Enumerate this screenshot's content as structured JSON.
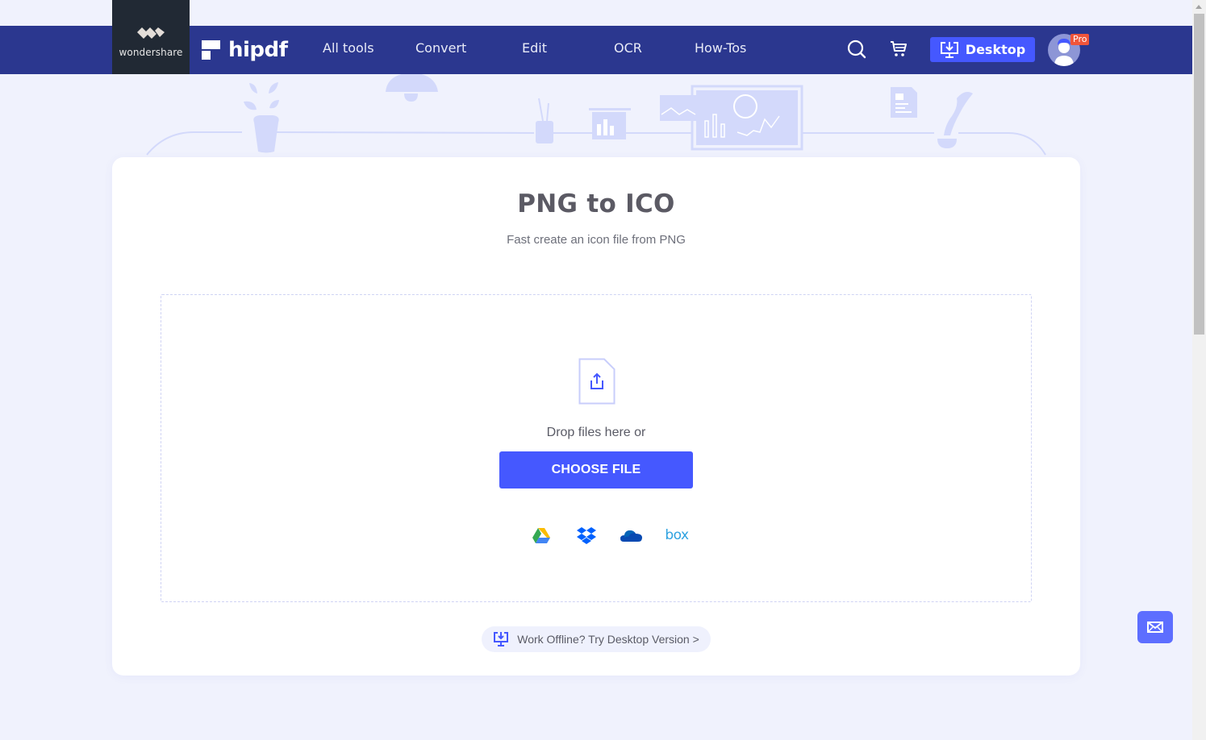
{
  "header": {
    "brand_parent": "wondershare",
    "brand": "hipdf",
    "nav": [
      {
        "label": "All tools"
      },
      {
        "label": "Convert"
      },
      {
        "label": "Edit"
      },
      {
        "label": "OCR"
      },
      {
        "label": "How-Tos"
      }
    ],
    "icons": {
      "search": "search-icon",
      "cart": "cart-icon"
    },
    "desktop_button": "Desktop",
    "pro_badge": "Pro"
  },
  "main": {
    "title": "PNG to ICO",
    "subtitle": "Fast create an icon file from PNG",
    "drop_text": "Drop files here or",
    "choose_button": "CHOOSE FILE",
    "cloud_sources": [
      {
        "name": "Google Drive",
        "icon": "google-drive-icon"
      },
      {
        "name": "Dropbox",
        "icon": "dropbox-icon"
      },
      {
        "name": "OneDrive",
        "icon": "onedrive-icon"
      },
      {
        "name": "Box",
        "icon": "box-icon",
        "label": "box"
      }
    ],
    "offline_link": "Work Offline? Try Desktop Version >"
  },
  "colors": {
    "nav_bg": "#2b378f",
    "accent": "#4558ff",
    "page_bg": "#f0f2fd",
    "pro_badge": "#f0553b"
  }
}
